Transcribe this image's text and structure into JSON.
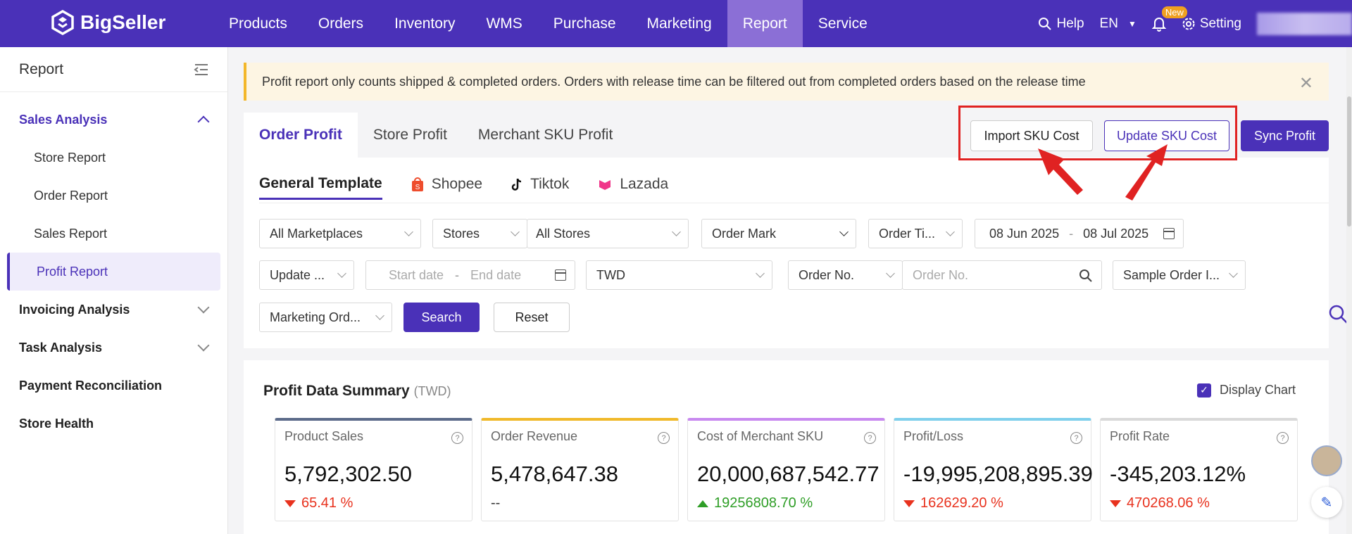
{
  "brand": {
    "name": "BigSeller",
    "accent": "#4a31b8"
  },
  "nav": {
    "items": [
      "Products",
      "Orders",
      "Inventory",
      "WMS",
      "Purchase",
      "Marketing",
      "Report",
      "Service"
    ],
    "active": "Report",
    "help": "Help",
    "lang": "EN",
    "new_badge": "New",
    "setting": "Setting"
  },
  "sidebar": {
    "title": "Report",
    "groups": [
      {
        "label": "Sales Analysis",
        "open": true
      },
      {
        "label": "Invoicing Analysis"
      },
      {
        "label": "Task Analysis"
      },
      {
        "label": "Payment Reconciliation"
      },
      {
        "label": "Store Health"
      }
    ],
    "sub_items": [
      "Store Report",
      "Order Report",
      "Sales Report",
      "Profit Report"
    ],
    "active_sub": "Profit Report"
  },
  "notice": {
    "text": "Profit report only counts shipped & completed orders. Orders with release time can be filtered out from completed orders based on the release time"
  },
  "tabs": [
    "Order Profit",
    "Store Profit",
    "Merchant SKU Profit"
  ],
  "actions": {
    "import": "Import SKU Cost",
    "update": "Update SKU Cost",
    "sync": "Sync Profit"
  },
  "subtabs": [
    "General Template",
    "Shopee",
    "Tiktok",
    "Lazada"
  ],
  "filters": {
    "marketplace": "All Marketplaces",
    "stores_label": "Stores",
    "stores_value": "All Stores",
    "order_mark": "Order Mark",
    "order_time": "Order Ti...",
    "date_from": "08 Jun 2025",
    "date_to": "08 Jul 2025",
    "update": "Update ...",
    "start_ph": "Start date",
    "end_ph": "End date",
    "currency": "TWD",
    "order_no_label": "Order No.",
    "order_no_ph": "Order No.",
    "sample": "Sample Order I...",
    "marketing": "Marketing Ord...",
    "search": "Search",
    "reset": "Reset",
    "date_sep": "-"
  },
  "summary": {
    "title": "Profit Data Summary",
    "currency": "(TWD)",
    "display_chart": "Display Chart",
    "metrics": [
      {
        "label": "Product Sales",
        "value": "5,792,302.50",
        "change": "65.41 %",
        "dir": "down",
        "color": "#5c6b8a"
      },
      {
        "label": "Order Revenue",
        "value": "5,478,647.38",
        "change": "--",
        "dir": "none",
        "color": "#f0b92a"
      },
      {
        "label": "Cost of Merchant SKU",
        "value": "20,000,687,542.77",
        "change": "19256808.70 %",
        "dir": "up",
        "color": "#c889ef"
      },
      {
        "label": "Profit/Loss",
        "value": "-19,995,208,895.39",
        "change": "162629.20 %",
        "dir": "down",
        "color": "#7fd0ec"
      },
      {
        "label": "Profit Rate",
        "value": "-345,203.12%",
        "change": "470268.06 %",
        "dir": "down",
        "color": "#d9d9d9"
      }
    ]
  }
}
